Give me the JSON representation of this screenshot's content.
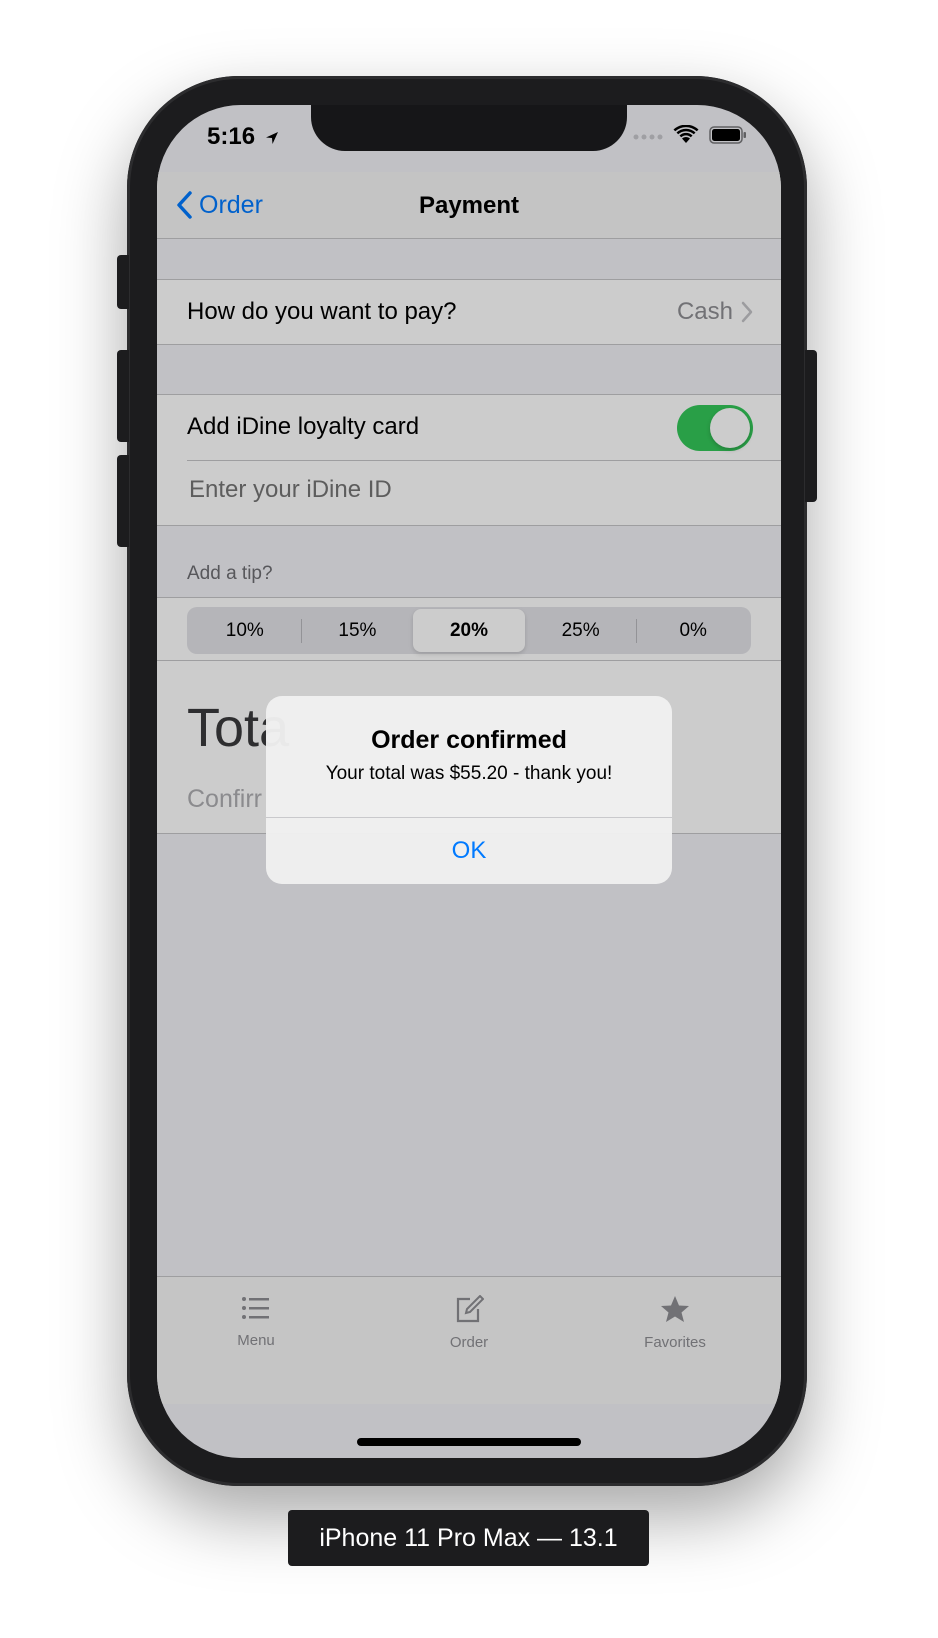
{
  "status_bar": {
    "time": "5:16"
  },
  "nav": {
    "back_label": "Order",
    "title": "Payment"
  },
  "payment": {
    "label": "How do you want to pay?",
    "value": "Cash"
  },
  "loyalty": {
    "label": "Add iDine loyalty card",
    "toggle_on": true,
    "id_placeholder": "Enter your iDine ID"
  },
  "tip": {
    "header": "Add a tip?",
    "options": [
      "10%",
      "15%",
      "20%",
      "25%",
      "0%"
    ],
    "selected": "20%"
  },
  "total": {
    "label_visible": "Tota"
  },
  "confirm": {
    "label_visible": "Confirr"
  },
  "tabs": [
    {
      "label": "Menu",
      "icon": "list-icon"
    },
    {
      "label": "Order",
      "icon": "compose-icon"
    },
    {
      "label": "Favorites",
      "icon": "star-icon"
    }
  ],
  "alert": {
    "title": "Order confirmed",
    "message": "Your total was $55.20 - thank you!",
    "button": "OK"
  },
  "device_label": "iPhone 11 Pro Max — 13.1",
  "colors": {
    "accent": "#007aff",
    "toggle": "#34c759"
  }
}
